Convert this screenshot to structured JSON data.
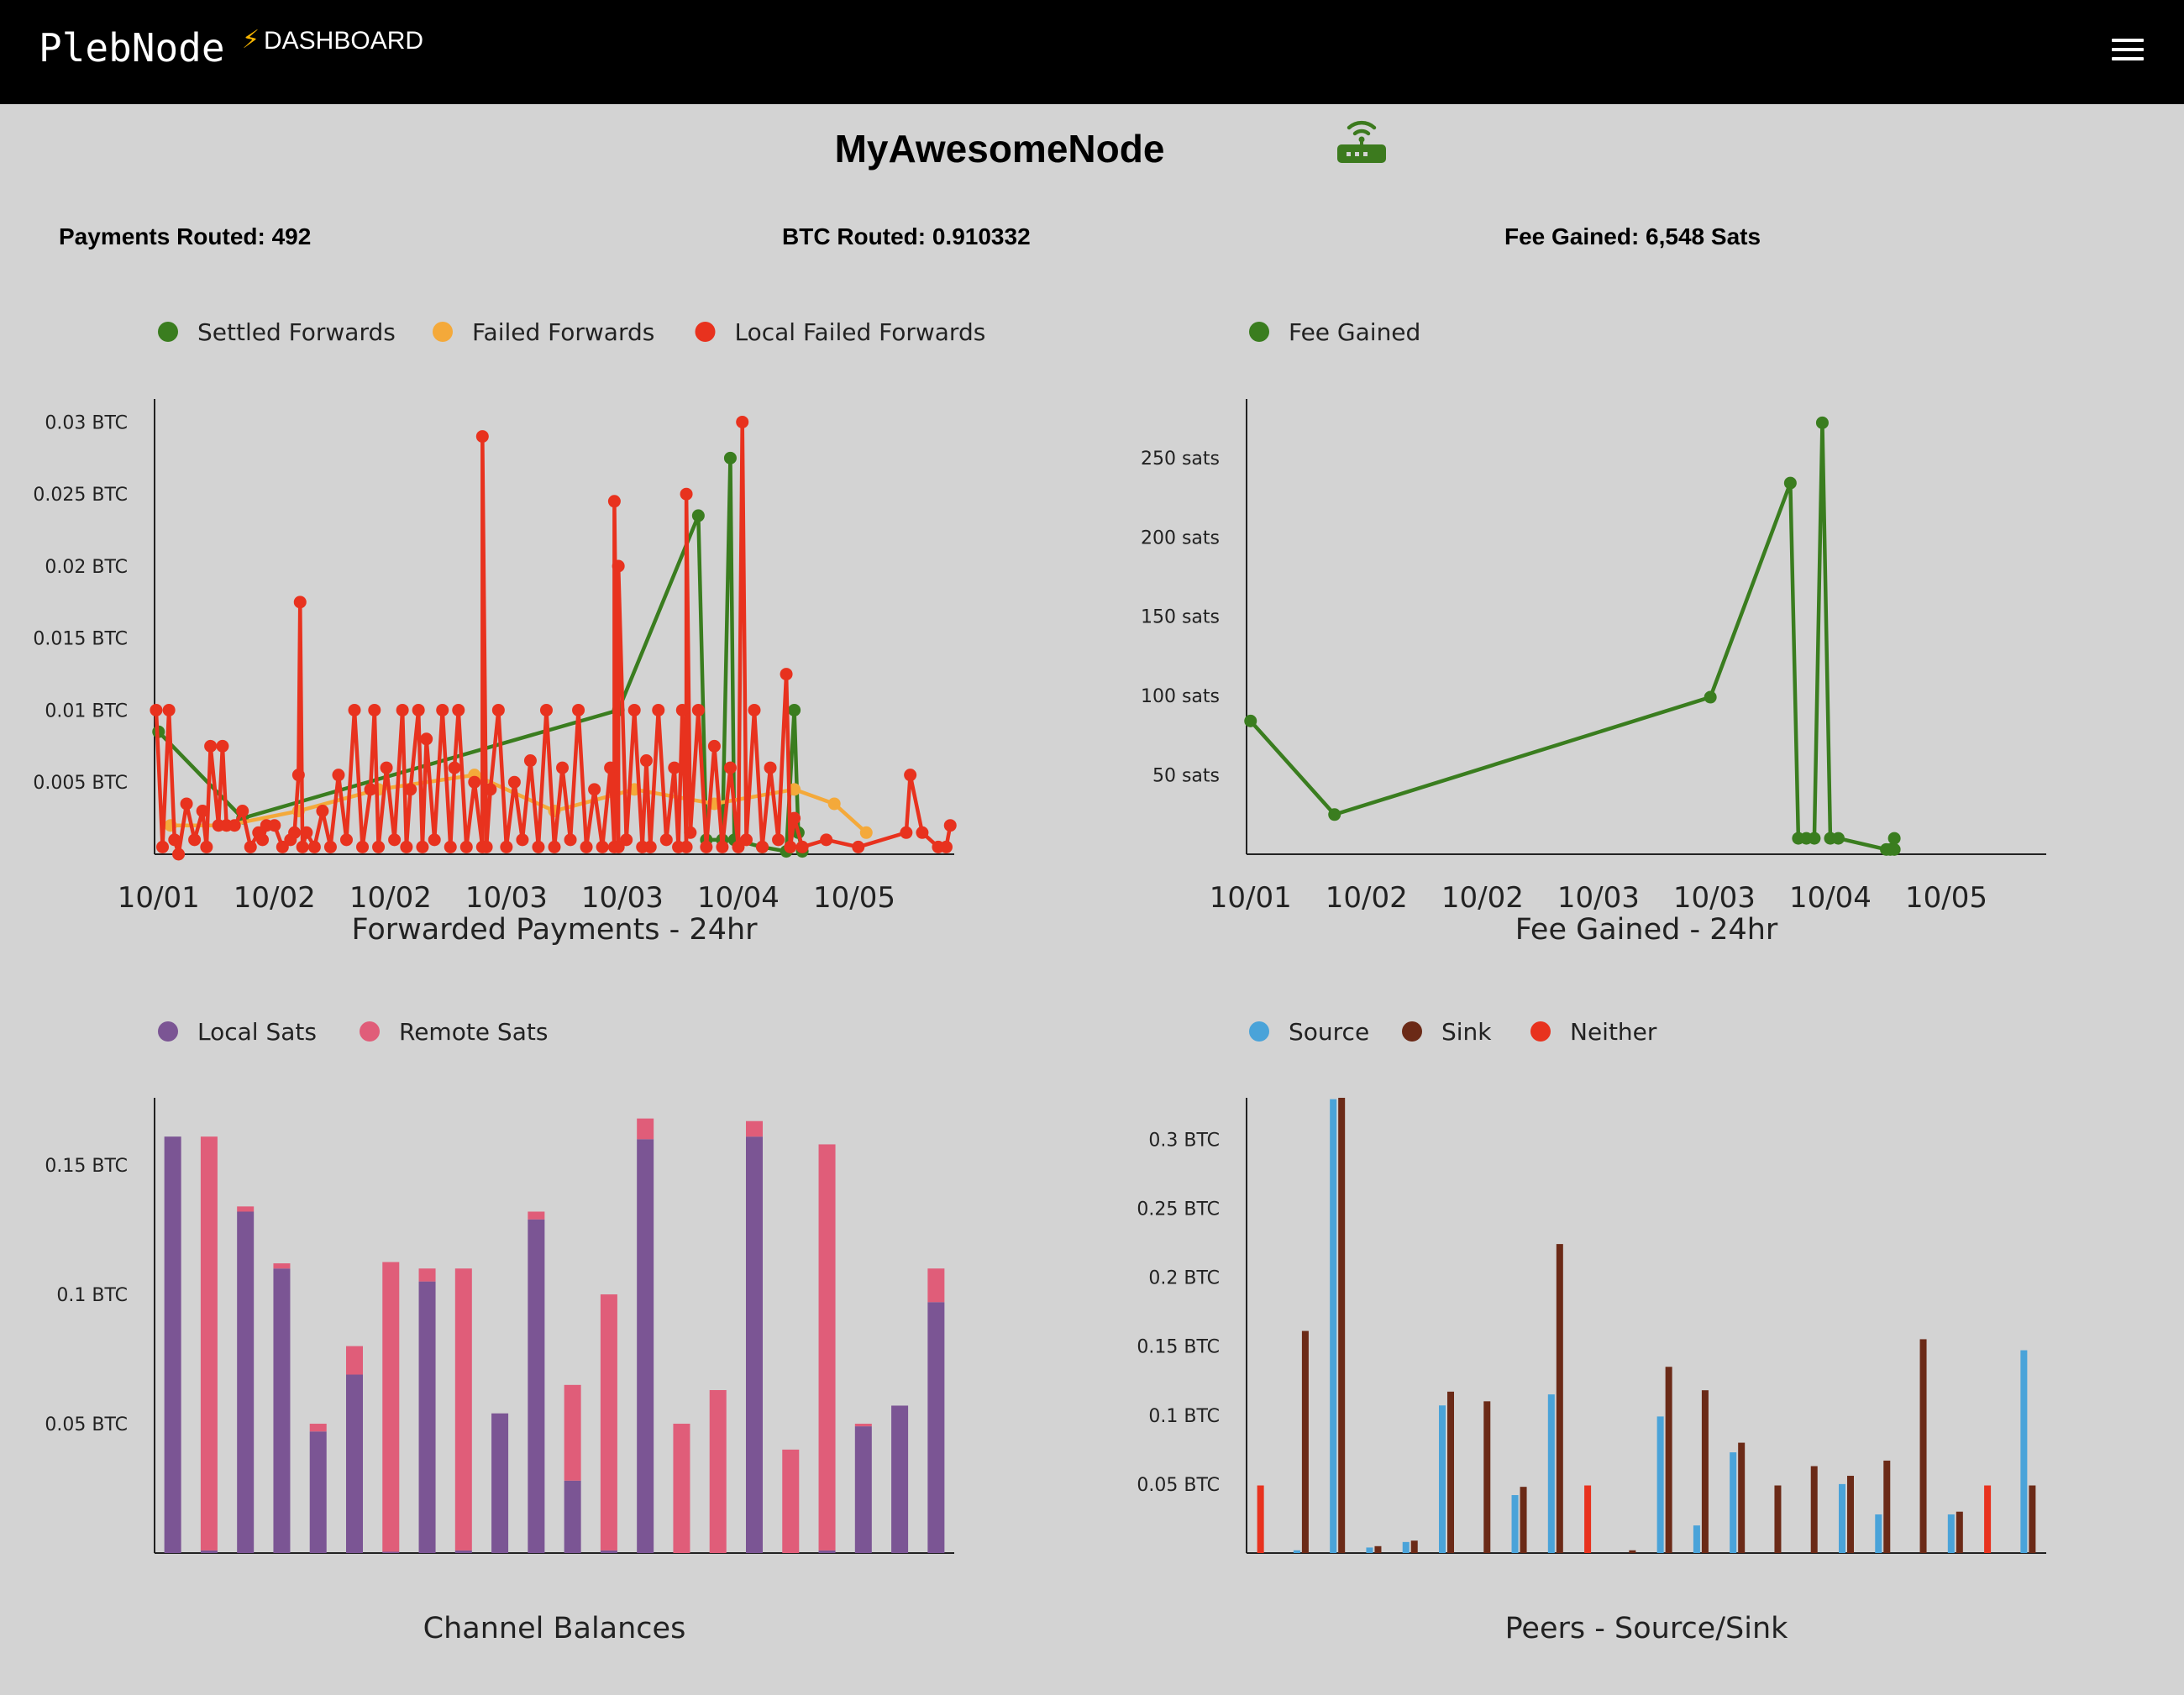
{
  "header": {
    "brand": "PlebNode",
    "bolt": "⚡",
    "subtitle": "DASHBOARD",
    "menu_icon": "hamburger-menu-icon"
  },
  "node": {
    "name": "MyAwesomeNode",
    "status_icon": "router-wifi-icon",
    "status_color": "#3c7a1e"
  },
  "stats": {
    "payments_routed": "Payments Routed: 492",
    "btc_routed": "BTC Routed: 0.910332",
    "fee_gained": "Fee Gained: 6,548 Sats"
  },
  "chart_data": [
    {
      "id": "forwarded-payments",
      "type": "line",
      "title": "Forwarded Payments - 24hr",
      "y_tick_labels": [
        "0.005 BTC",
        "0.01 BTC",
        "0.015 BTC",
        "0.02 BTC",
        "0.025 BTC",
        "0.03 BTC"
      ],
      "y_ticks": [
        0.005,
        0.01,
        0.015,
        0.02,
        0.025,
        0.03
      ],
      "ylim": [
        0,
        0.0316
      ],
      "x_tick_labels": [
        "10/01",
        "10/02",
        "10/02",
        "10/03",
        "10/03",
        "10/04",
        "10/05"
      ],
      "x_tick_pos": [
        0.005,
        0.15,
        0.295,
        0.44,
        0.585,
        0.73,
        0.875
      ],
      "legend_position": "top-left",
      "series": [
        {
          "name": "Settled Forwards",
          "color": "#3a7d1f",
          "points": [
            [
              0.005,
              0.0085
            ],
            [
              0.11,
              0.0025
            ],
            [
              0.58,
              0.01
            ],
            [
              0.68,
              0.0235
            ],
            [
              0.69,
              0.001
            ],
            [
              0.71,
              0.001
            ],
            [
              0.72,
              0.0275
            ],
            [
              0.725,
              0.001
            ],
            [
              0.76,
              0.0005
            ],
            [
              0.79,
              0.0002
            ],
            [
              0.8,
              0.01
            ],
            [
              0.805,
              0.0015
            ],
            [
              0.81,
              0.0002
            ]
          ]
        },
        {
          "name": "Failed Forwards",
          "color": "#f4a93a",
          "points": [
            [
              0.02,
              0.002
            ],
            [
              0.09,
              0.002
            ],
            [
              0.18,
              0.003
            ],
            [
              0.28,
              0.0045
            ],
            [
              0.4,
              0.0055
            ],
            [
              0.5,
              0.003
            ],
            [
              0.6,
              0.0045
            ],
            [
              0.7,
              0.0035
            ],
            [
              0.8,
              0.0045
            ],
            [
              0.85,
              0.0035
            ],
            [
              0.89,
              0.0015
            ]
          ]
        },
        {
          "name": "Local Failed Forwards",
          "color": "#e8321e",
          "points": [
            [
              0.002,
              0.01
            ],
            [
              0.01,
              0.0005
            ],
            [
              0.018,
              0.01
            ],
            [
              0.025,
              0.001
            ],
            [
              0.03,
              0.0
            ],
            [
              0.04,
              0.0035
            ],
            [
              0.05,
              0.001
            ],
            [
              0.06,
              0.003
            ],
            [
              0.065,
              0.0005
            ],
            [
              0.07,
              0.0075
            ],
            [
              0.08,
              0.002
            ],
            [
              0.085,
              0.0075
            ],
            [
              0.09,
              0.002
            ],
            [
              0.1,
              0.002
            ],
            [
              0.11,
              0.003
            ],
            [
              0.12,
              0.0005
            ],
            [
              0.13,
              0.0015
            ],
            [
              0.135,
              0.001
            ],
            [
              0.14,
              0.002
            ],
            [
              0.15,
              0.002
            ],
            [
              0.16,
              0.0005
            ],
            [
              0.17,
              0.001
            ],
            [
              0.175,
              0.0015
            ],
            [
              0.18,
              0.0055
            ],
            [
              0.182,
              0.0175
            ],
            [
              0.185,
              0.0005
            ],
            [
              0.19,
              0.0015
            ],
            [
              0.2,
              0.0005
            ],
            [
              0.21,
              0.003
            ],
            [
              0.22,
              0.0005
            ],
            [
              0.23,
              0.0055
            ],
            [
              0.24,
              0.001
            ],
            [
              0.25,
              0.01
            ],
            [
              0.26,
              0.0005
            ],
            [
              0.27,
              0.0045
            ],
            [
              0.275,
              0.01
            ],
            [
              0.28,
              0.0005
            ],
            [
              0.29,
              0.006
            ],
            [
              0.3,
              0.001
            ],
            [
              0.31,
              0.01
            ],
            [
              0.315,
              0.0005
            ],
            [
              0.32,
              0.0045
            ],
            [
              0.33,
              0.01
            ],
            [
              0.335,
              0.0005
            ],
            [
              0.34,
              0.008
            ],
            [
              0.35,
              0.001
            ],
            [
              0.36,
              0.01
            ],
            [
              0.37,
              0.0005
            ],
            [
              0.375,
              0.006
            ],
            [
              0.38,
              0.01
            ],
            [
              0.39,
              0.0005
            ],
            [
              0.4,
              0.005
            ],
            [
              0.41,
              0.0005
            ],
            [
              0.41,
              0.029
            ],
            [
              0.415,
              0.0005
            ],
            [
              0.42,
              0.0045
            ],
            [
              0.43,
              0.01
            ],
            [
              0.44,
              0.0005
            ],
            [
              0.45,
              0.005
            ],
            [
              0.46,
              0.001
            ],
            [
              0.47,
              0.0065
            ],
            [
              0.48,
              0.0005
            ],
            [
              0.49,
              0.01
            ],
            [
              0.5,
              0.0005
            ],
            [
              0.51,
              0.006
            ],
            [
              0.52,
              0.001
            ],
            [
              0.53,
              0.01
            ],
            [
              0.54,
              0.0005
            ],
            [
              0.55,
              0.0045
            ],
            [
              0.56,
              0.0005
            ],
            [
              0.57,
              0.006
            ],
            [
              0.575,
              0.0005
            ],
            [
              0.575,
              0.0245
            ],
            [
              0.58,
              0.0005
            ],
            [
              0.58,
              0.02
            ],
            [
              0.59,
              0.001
            ],
            [
              0.6,
              0.01
            ],
            [
              0.61,
              0.0005
            ],
            [
              0.615,
              0.0065
            ],
            [
              0.62,
              0.0005
            ],
            [
              0.63,
              0.01
            ],
            [
              0.64,
              0.001
            ],
            [
              0.65,
              0.006
            ],
            [
              0.655,
              0.0005
            ],
            [
              0.66,
              0.01
            ],
            [
              0.665,
              0.0005
            ],
            [
              0.665,
              0.025
            ],
            [
              0.67,
              0.0015
            ],
            [
              0.68,
              0.01
            ],
            [
              0.69,
              0.0005
            ],
            [
              0.7,
              0.0075
            ],
            [
              0.71,
              0.0005
            ],
            [
              0.72,
              0.006
            ],
            [
              0.73,
              0.0005
            ],
            [
              0.735,
              0.03
            ],
            [
              0.74,
              0.001
            ],
            [
              0.75,
              0.01
            ],
            [
              0.76,
              0.0005
            ],
            [
              0.77,
              0.006
            ],
            [
              0.78,
              0.001
            ],
            [
              0.79,
              0.0125
            ],
            [
              0.795,
              0.0005
            ],
            [
              0.8,
              0.0025
            ],
            [
              0.81,
              0.0005
            ],
            [
              0.84,
              0.001
            ],
            [
              0.88,
              0.0005
            ],
            [
              0.94,
              0.0015
            ],
            [
              0.945,
              0.0055
            ],
            [
              0.96,
              0.0015
            ],
            [
              0.98,
              0.0005
            ],
            [
              0.99,
              0.0005
            ],
            [
              0.995,
              0.002
            ]
          ]
        }
      ]
    },
    {
      "id": "fee-gained",
      "type": "line",
      "title": "Fee Gained - 24hr",
      "y_tick_labels": [
        "50 sats",
        "100 sats",
        "150 sats",
        "200 sats",
        "250 sats"
      ],
      "y_ticks": [
        50,
        100,
        150,
        200,
        250
      ],
      "ylim": [
        0,
        287
      ],
      "x_tick_labels": [
        "10/01",
        "10/02",
        "10/02",
        "10/03",
        "10/03",
        "10/04",
        "10/05"
      ],
      "x_tick_pos": [
        0.005,
        0.15,
        0.295,
        0.44,
        0.585,
        0.73,
        0.875
      ],
      "legend_position": "top-left",
      "series": [
        {
          "name": "Fee Gained",
          "color": "#3a7d1f",
          "points": [
            [
              0.005,
              84
            ],
            [
              0.11,
              25
            ],
            [
              0.58,
              99
            ],
            [
              0.68,
              234
            ],
            [
              0.69,
              10
            ],
            [
              0.7,
              10
            ],
            [
              0.71,
              10
            ],
            [
              0.72,
              272
            ],
            [
              0.73,
              10
            ],
            [
              0.74,
              10
            ],
            [
              0.8,
              3
            ],
            [
              0.805,
              3
            ],
            [
              0.81,
              10
            ],
            [
              0.81,
              3
            ]
          ]
        }
      ]
    },
    {
      "id": "channel-balances",
      "type": "bar",
      "stacked": true,
      "title": "Channel Balances",
      "y_tick_labels": [
        "0.05 BTC",
        "0.1 BTC",
        "0.15 BTC"
      ],
      "y_ticks": [
        0.05,
        0.1,
        0.15
      ],
      "ylim": [
        0,
        0.176
      ],
      "legend_position": "top-left",
      "series": [
        {
          "name": "Local Sats",
          "color": "#7b5594",
          "values": [
            0.161,
            0.001,
            0.132,
            0.11,
            0.047,
            0.069,
            0.0005,
            0.105,
            0.001,
            0.054,
            0.129,
            0.028,
            0.001,
            0.16,
            0,
            0,
            0.161,
            0,
            0.001,
            0.049,
            0.057,
            0.097
          ]
        },
        {
          "name": "Remote Sats",
          "color": "#e05d79",
          "values": [
            0,
            0.16,
            0.002,
            0.002,
            0.003,
            0.011,
            0.112,
            0.005,
            0.109,
            0,
            0.003,
            0.037,
            0.099,
            0.008,
            0.05,
            0.063,
            0.006,
            0.04,
            0.157,
            0.001,
            0,
            0.013
          ]
        }
      ]
    },
    {
      "id": "peers-source-sink",
      "type": "bar",
      "stacked": false,
      "title": "Peers - Source/Sink",
      "y_tick_labels": [
        "0.05 BTC",
        "0.1 BTC",
        "0.15 BTC",
        "0.2 BTC",
        "0.25 BTC",
        "0.3 BTC"
      ],
      "y_ticks": [
        0.05,
        0.1,
        0.15,
        0.2,
        0.25,
        0.3
      ],
      "ylim": [
        0,
        0.33
      ],
      "legend_position": "top-left",
      "series": [
        {
          "name": "Source",
          "color": "#4aa3d9",
          "values": [
            0,
            0.002,
            0.329,
            0.004,
            0.008,
            0.107,
            0,
            0.042,
            0.115,
            0,
            0,
            0.099,
            0.02,
            0.073,
            0,
            0,
            0.05,
            0.028,
            0,
            0.028,
            0,
            0.147
          ]
        },
        {
          "name": "Sink",
          "color": "#6b2a17",
          "values": [
            0,
            0.161,
            0.33,
            0.005,
            0.009,
            0.117,
            0.11,
            0.048,
            0.224,
            0,
            0.002,
            0.135,
            0.118,
            0.08,
            0.049,
            0.063,
            0.056,
            0.067,
            0.155,
            0.03,
            0,
            0.049
          ]
        },
        {
          "name": "Neither",
          "color": "#e8321e",
          "values": [
            0.049,
            0,
            0,
            0,
            0,
            0,
            0,
            0,
            0,
            0.049,
            0,
            0,
            0,
            0,
            0,
            0,
            0,
            0,
            0,
            0,
            0.049,
            0
          ]
        }
      ]
    }
  ]
}
